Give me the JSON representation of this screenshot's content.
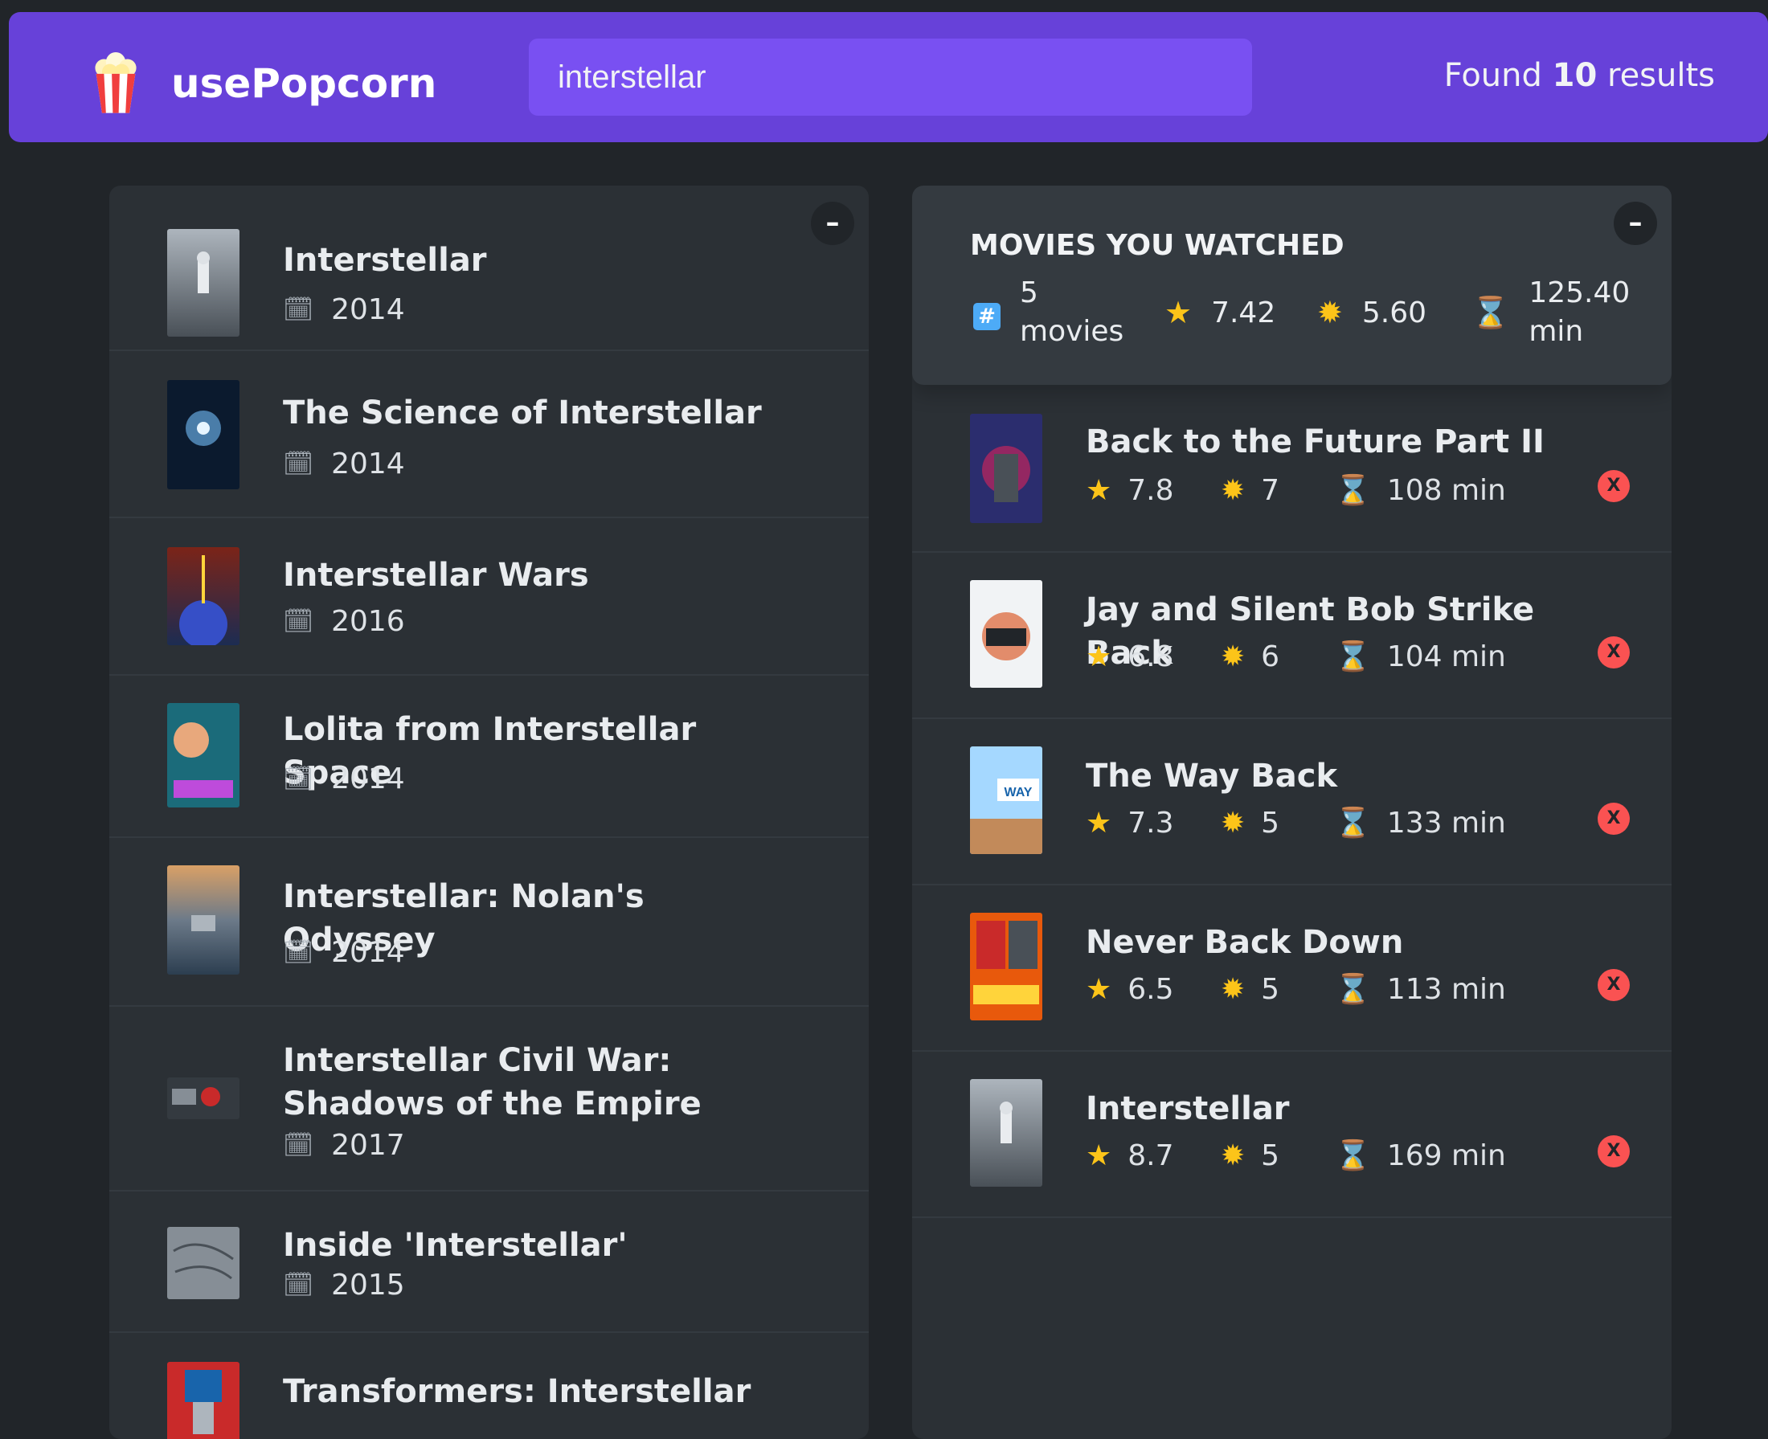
{
  "nav": {
    "logo_text": "usePopcorn",
    "search_value": "interstellar",
    "results_prefix": "Found ",
    "results_count": "10",
    "results_suffix": " results"
  },
  "toggle_label": "–",
  "search_results": [
    {
      "title": "Interstellar",
      "year": "2014"
    },
    {
      "title": "The Science of Interstellar",
      "year": "2014"
    },
    {
      "title": "Interstellar Wars",
      "year": "2016"
    },
    {
      "title": "Lolita from Interstellar Space",
      "year": "2014"
    },
    {
      "title": "Interstellar: Nolan's Odyssey",
      "year": "2014"
    },
    {
      "title": "Interstellar Civil War: Shadows of the Empire",
      "year": "2017"
    },
    {
      "title": "Inside 'Interstellar'",
      "year": "2015"
    },
    {
      "title": "Transformers: Interstellar",
      "year": ""
    }
  ],
  "summary": {
    "heading": "MOVIES YOU WATCHED",
    "count_line1": "5",
    "count_line2": "movies",
    "avg_imdb": "7.42",
    "avg_user": "5.60",
    "avg_runtime_line1": "125.40",
    "avg_runtime_line2": "min"
  },
  "watched": [
    {
      "title": "Back to the Future Part II",
      "imdb": "7.8",
      "user": "7",
      "runtime": "108 min"
    },
    {
      "title": "Jay and Silent Bob Strike Back",
      "imdb": "6.8",
      "user": "6",
      "runtime": "104 min"
    },
    {
      "title": "The Way Back",
      "imdb": "7.3",
      "user": "5",
      "runtime": "133 min"
    },
    {
      "title": "Never Back Down",
      "imdb": "6.5",
      "user": "5",
      "runtime": "113 min"
    },
    {
      "title": "Interstellar",
      "imdb": "8.7",
      "user": "5",
      "runtime": "169 min"
    }
  ],
  "delete_label": "X",
  "colors": {
    "nav": "#6741d9",
    "search": "#7950f2",
    "background": "#212529",
    "panel": "#2b3035",
    "delete": "#fa5252"
  }
}
